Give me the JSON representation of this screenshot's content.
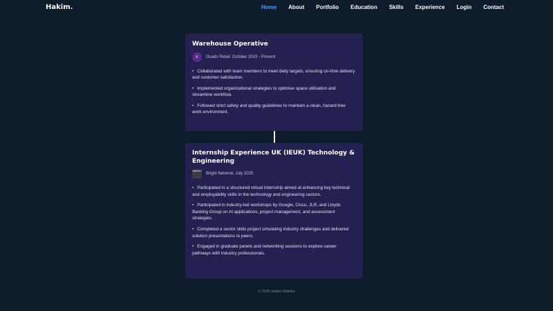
{
  "brand": {
    "logo": "Hakim."
  },
  "nav": {
    "items": [
      {
        "label": "Home",
        "active": true
      },
      {
        "label": "About",
        "active": false
      },
      {
        "label": "Portfolio",
        "active": false
      },
      {
        "label": "Education",
        "active": false
      },
      {
        "label": "Skills",
        "active": false
      },
      {
        "label": "Experience",
        "active": false
      },
      {
        "label": "Login",
        "active": false
      },
      {
        "label": "Contact",
        "active": false
      }
    ]
  },
  "experience": [
    {
      "title": "Warehouse Operative",
      "company": "Ocado Retail: October 2023 - Present",
      "logo_icon": "ocado-logo",
      "logo_text": "C",
      "bullets": [
        "Collaborated with team members to meet daily targets, ensuring on-time delivery and customer satisfaction.",
        "Implemented organizational strategies to optimise space utilisation and streamline workflow.",
        "Followed strict safety and quality guidelines to maintain a clean, hazard-free work environment."
      ]
    },
    {
      "title": "Internship Experience UK (IEUK) Technology & Engineering",
      "company": "Bright Netwrok: July 2025",
      "logo_icon": "bright-network-logo",
      "logo_text": "BRIGHT",
      "bullets": [
        "Participated in a structured virtual internship aimed at enhancing key technical and employability skills in the technology and engineering sectors.",
        "Participated in industry-led workshops by Google, Cisco, JLR, and Lloyds Banking Group on AI applications, project management, and assessment strategies.",
        "Completed a sector skills project simulating industry challenges and delivered solution presentations to peers.",
        "Engaged in graduate panels and networking sessions to explore career pathways with industry professionals."
      ]
    }
  ],
  "footer": {
    "text": "© 2025 Hakim Mahike"
  },
  "colors": {
    "background": "#0d1b2a",
    "card": "#232150",
    "accent": "#3ea2ff"
  }
}
